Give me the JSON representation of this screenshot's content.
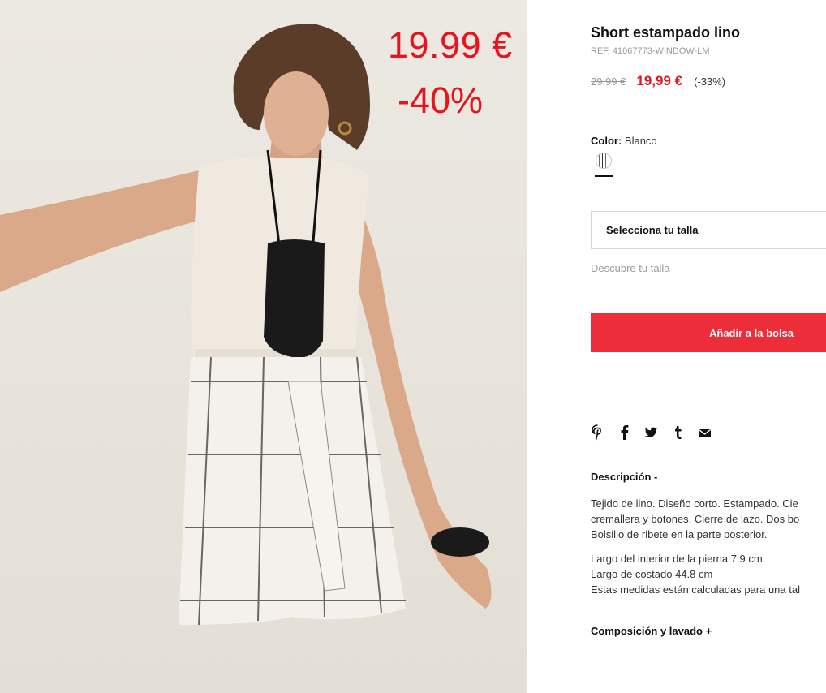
{
  "promo": {
    "price": "19.99 €",
    "discount": "-40%"
  },
  "product": {
    "title": "Short estampado lino",
    "ref": "REF. 41067773-WINDOW-LM",
    "old_price": "29,99 €",
    "new_price": "19,99 €",
    "discount_pct": "(-33%)",
    "color_label": "Color:",
    "color_value": "Blanco",
    "size_placeholder": "Selecciona tu talla",
    "size_guide": "Descubre tu talla",
    "add_to_bag": "Añadir a la bolsa"
  },
  "social": {
    "icons": [
      "pinterest-icon",
      "facebook-icon",
      "twitter-icon",
      "tumblr-icon",
      "email-icon"
    ]
  },
  "description": {
    "heading": "Descripción -",
    "paragraph1": [
      "Tejido de lino. Diseño corto. Estampado. Cie",
      "cremallera y botones. Cierre de lazo. Dos bo",
      "Bolsillo de ribete en la parte posterior."
    ],
    "paragraph2": [
      "Largo del interior de la pierna 7.9 cm",
      "Largo de costado 44.8 cm",
      "Estas medidas están calculadas para una tal"
    ]
  },
  "composition": {
    "heading": "Composición y lavado +"
  },
  "colors": {
    "accent_red": "#e8131d",
    "button_red": "#ee2d3a"
  }
}
